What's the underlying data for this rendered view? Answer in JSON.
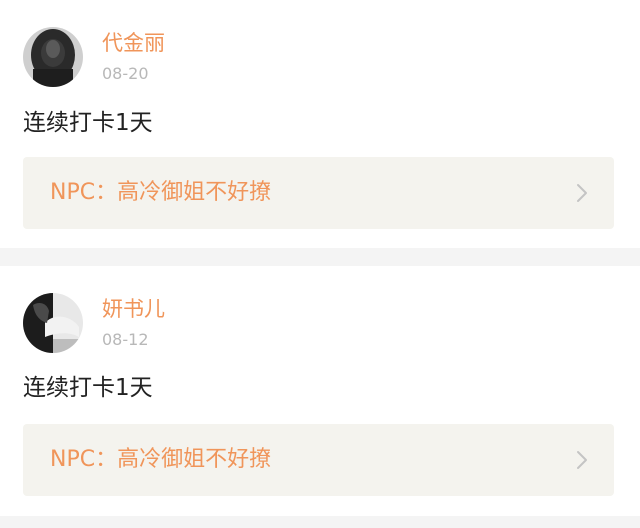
{
  "posts": [
    {
      "username": "代金丽",
      "date": "08-20",
      "content": "连续打卡1天",
      "npc_label": "NPC：高冷御姐不好撩",
      "avatar_icon": "user-avatar-dark-photo",
      "chevron_icon": "chevron-right-icon"
    },
    {
      "username": "妍书儿",
      "date": "08-12",
      "content": "连续打卡1天",
      "npc_label": "NPC：高冷御姐不好撩",
      "avatar_icon": "user-avatar-bw-photo",
      "chevron_icon": "chevron-right-icon"
    }
  ],
  "colors": {
    "accent": "#f0955a",
    "date_gray": "#b8b8b8",
    "npc_bg": "#f4f3ee",
    "separator": "#f4f4f4",
    "text": "#222222"
  }
}
